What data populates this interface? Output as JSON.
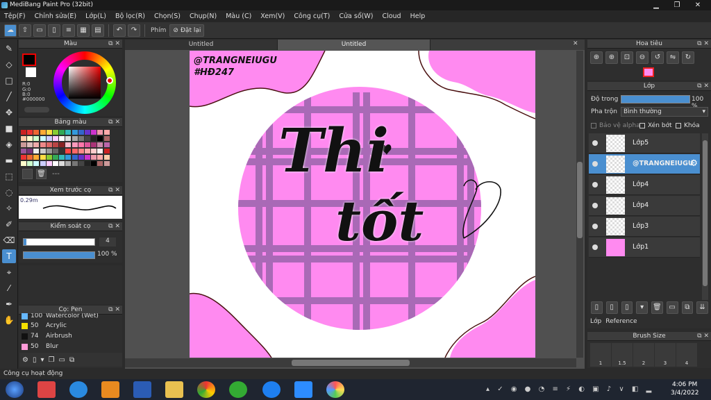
{
  "window": {
    "title": "MediBang Paint Pro (32bit)",
    "min": "▁",
    "max": "❐",
    "close": "✕"
  },
  "menu": [
    "Tệp(F)",
    "Chỉnh sửa(E)",
    "Lớp(L)",
    "Bộ lọc(R)",
    "Chọn(S)",
    "Chụp(N)",
    "Màu (C)",
    "Xem(V)",
    "Công cụ(T)",
    "Cửa sổ(W)",
    "Cloud",
    "Help"
  ],
  "toolbar": {
    "key_label": "Phím",
    "reset_label": "Đặt lại"
  },
  "color_panel": {
    "title": "Màu",
    "r": "R:0",
    "g": "G:0",
    "b": "B:0",
    "hex": "#000000"
  },
  "palette_panel": {
    "title": "Bảng màu",
    "more": "---"
  },
  "brush_preview": {
    "title": "Xem trước cọ",
    "size": "0.29m"
  },
  "brush_control": {
    "title": "Kiểm soát cọ",
    "size_value": "4",
    "opacity_value": "100 %"
  },
  "brush_list": {
    "title": "Cọ: Pen",
    "items": [
      {
        "size": "100",
        "name": "Watercolor (Wet)",
        "color": "#66b8ff"
      },
      {
        "size": "50",
        "name": "Acrylic",
        "color": "#f5e000"
      },
      {
        "size": "74",
        "name": "Airbrush",
        "color": "#111111"
      },
      {
        "size": "50",
        "name": "Blur",
        "color": "#ff9bd8"
      }
    ]
  },
  "tabs": [
    "Untitled",
    "Untitled"
  ],
  "canvas": {
    "tag1": "@TRANGNEIUGU",
    "tag2": "#HĐ247",
    "word1": "Thi",
    "word2": "tốt"
  },
  "navigator": {
    "title": "Hoa tiêu"
  },
  "layers_panel": {
    "title": "Lớp",
    "opacity_label": "Độ trong",
    "opacity_value": "100 %",
    "blend_label": "Pha trộn",
    "blend_value": "Bình thường",
    "protect_alpha": "Bảo vệ alpha",
    "clipping": "Xén bớt",
    "lock": "Khóa",
    "layers": [
      {
        "name": "Lớp5",
        "selected": false
      },
      {
        "name": "@TRANGNEIUGU",
        "selected": true
      },
      {
        "name": "Lớp4",
        "selected": false
      },
      {
        "name": "Lớp4",
        "selected": false
      },
      {
        "name": "Lớp3",
        "selected": false
      },
      {
        "name": "Lớp1",
        "selected": false
      }
    ],
    "tab_layer": "Lớp",
    "tab_reference": "Reference"
  },
  "brush_size": {
    "title": "Brush Size",
    "sizes": [
      "1",
      "1.5",
      "2",
      "3",
      "4"
    ]
  },
  "status": {
    "text": "Công cụ hoạt động"
  },
  "taskbar": {
    "time": "4:06 PM",
    "date": "3/4/2022"
  }
}
